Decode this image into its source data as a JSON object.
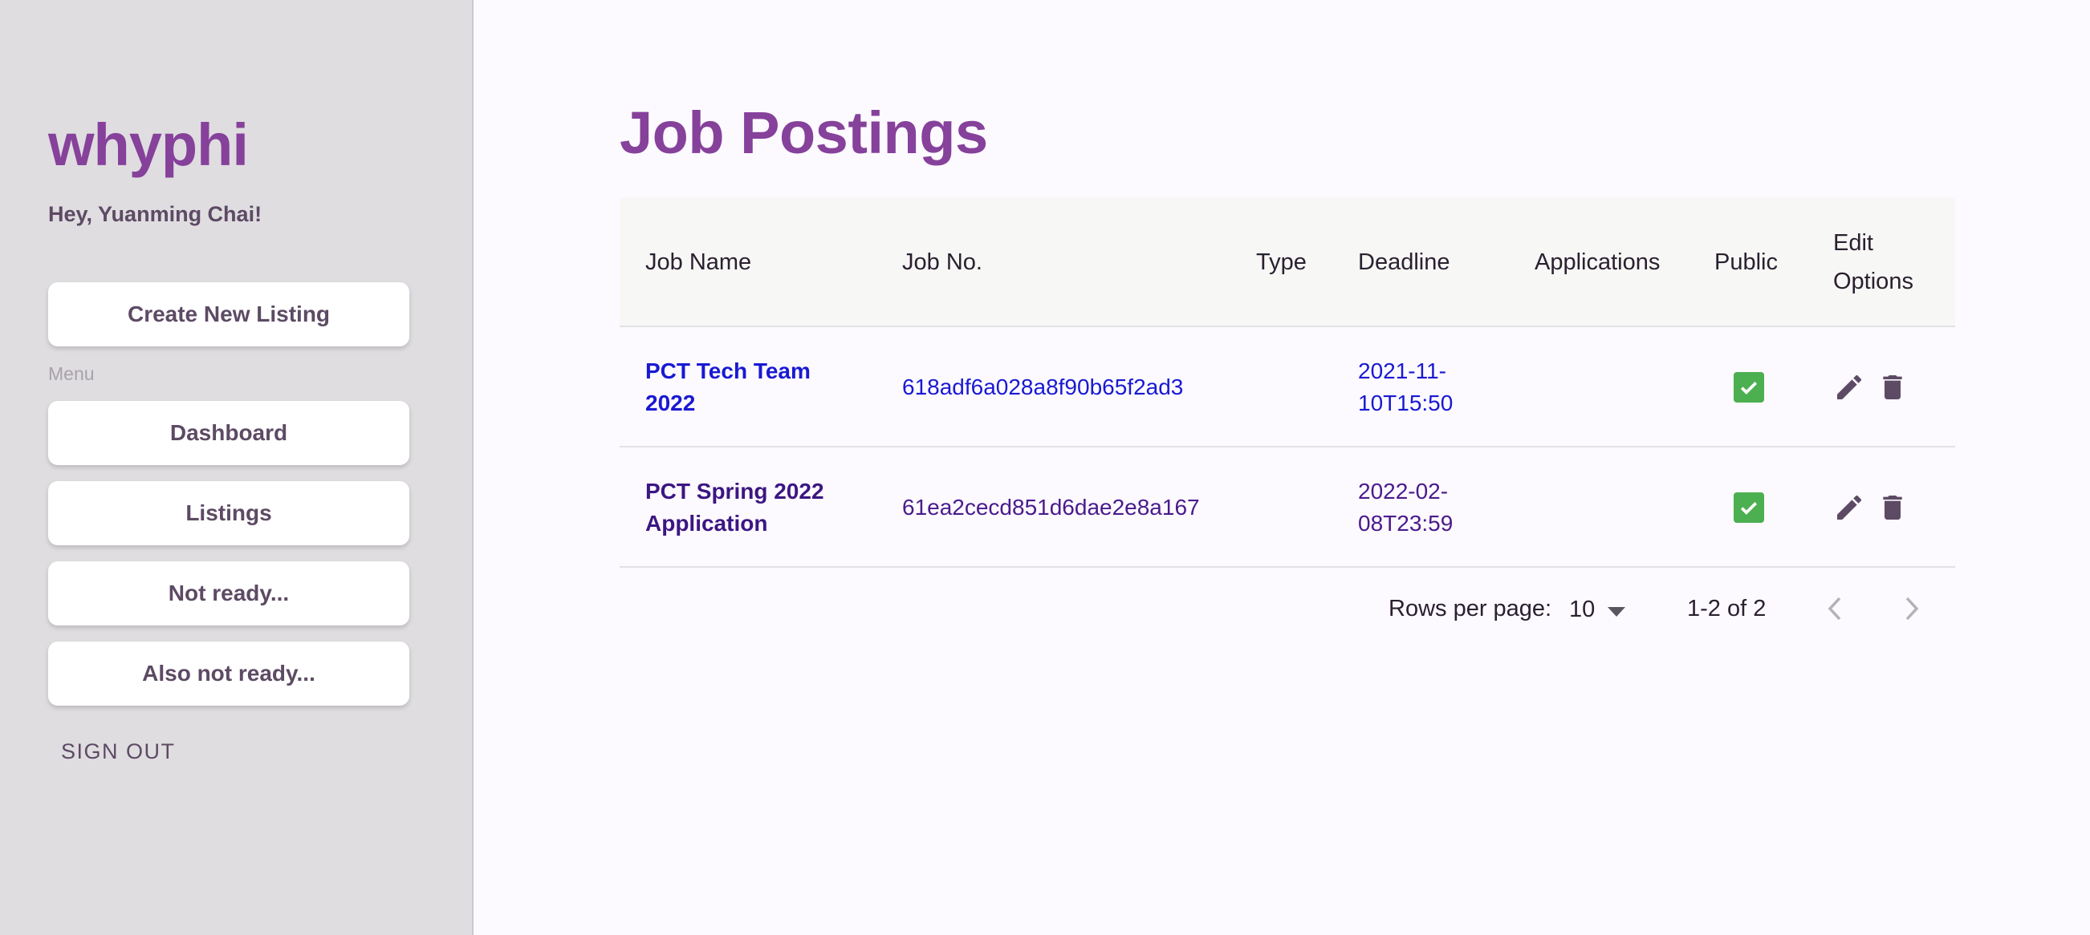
{
  "sidebar": {
    "brand": "whyphi",
    "greeting": "Hey, Yuanming Chai!",
    "create_label": "Create New Listing",
    "menu_label": "Menu",
    "items": [
      {
        "label": "Dashboard"
      },
      {
        "label": "Listings"
      },
      {
        "label": "Not ready..."
      },
      {
        "label": "Also not ready..."
      }
    ],
    "signout_label": "SIGN OUT"
  },
  "main": {
    "title": "Job Postings",
    "columns": {
      "name": "Job Name",
      "number": "Job No.",
      "type": "Type",
      "deadline": "Deadline",
      "applications": "Applications",
      "public": "Public",
      "edit_line1": "Edit",
      "edit_line2": "Options"
    },
    "rows": [
      {
        "name_line1": "PCT Tech Team",
        "name_line2": "2022",
        "number": "618adf6a028a8f90b65f2ad3",
        "type": "",
        "deadline_line1": "2021-11-",
        "deadline_line2": "10T15:50",
        "applications": "",
        "public": true
      },
      {
        "name_line1": "PCT Spring 2022",
        "name_line2": "Application",
        "number": "61ea2cecd851d6dae2e8a167",
        "type": "",
        "deadline_line1": "2022-02-",
        "deadline_line2": "08T23:59",
        "applications": "",
        "public": true
      }
    ],
    "pagination": {
      "rows_per_page_label": "Rows per page:",
      "rows_per_page_value": "10",
      "range": "1-2 of 2"
    }
  },
  "icons": {
    "edit": "pencil-icon",
    "delete": "trash-icon",
    "public": "checkbox-checked-icon",
    "dropdown": "caret-down-icon",
    "prev": "chevron-left-icon",
    "next": "chevron-right-icon"
  },
  "colors": {
    "accent": "#86419b",
    "sidebar_bg": "#dfdde0",
    "text_muted": "#5d4a64",
    "checkbox": "#4caf50"
  }
}
